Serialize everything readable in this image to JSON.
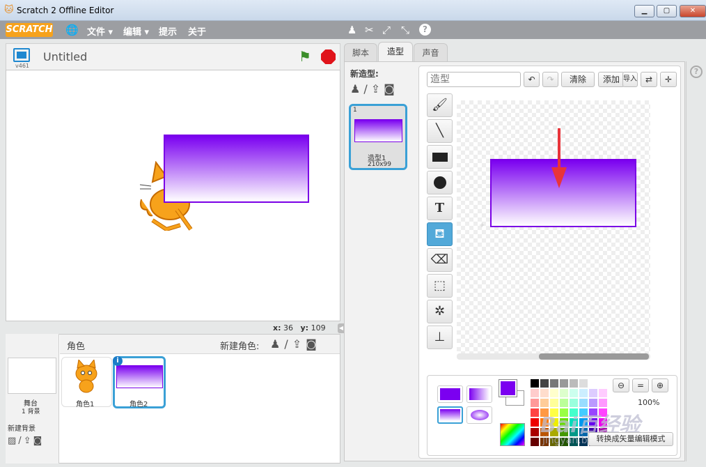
{
  "window": {
    "title": "Scratch 2 Offline Editor",
    "minimize": "▁",
    "maximize": "▢",
    "close": "✕"
  },
  "menubar": {
    "logo": "SCRATCH",
    "items": [
      {
        "label": "文件 ▾"
      },
      {
        "label": "编辑 ▾"
      },
      {
        "label": "提示"
      },
      {
        "label": "关于"
      }
    ]
  },
  "stage": {
    "project_title": "Untitled",
    "version": "v461",
    "x_label": "x:",
    "x_value": "36",
    "y_label": "y:",
    "y_value": "109"
  },
  "sprites": {
    "header": "角色",
    "new_sprite_label": "新建角色:",
    "stage_label": "舞台",
    "stage_backdrops": "1 背景",
    "new_backdrop_label": "新建背景",
    "list": [
      {
        "name": "角色1"
      },
      {
        "name": "角色2"
      }
    ]
  },
  "tabs": [
    {
      "label": "脚本"
    },
    {
      "label": "造型"
    },
    {
      "label": "声音"
    }
  ],
  "costumes": {
    "new_costume_label": "新造型:",
    "items": [
      {
        "index": "1",
        "name": "造型1",
        "size": "210x99"
      }
    ]
  },
  "paint": {
    "name_placeholder": "造型",
    "clear": "清除",
    "add": "添加",
    "import": "导入",
    "zoom": "100%",
    "convert": "转换成矢量编辑模式",
    "watermark": "Bai百经验",
    "watermark2": "jingyan.baidu.com",
    "help": "?",
    "fg_color": "#7b00f0",
    "bg_color": "#ffffff"
  },
  "colors": {
    "accent": "#7b00f0",
    "selected_border": "#3aa0d6"
  }
}
